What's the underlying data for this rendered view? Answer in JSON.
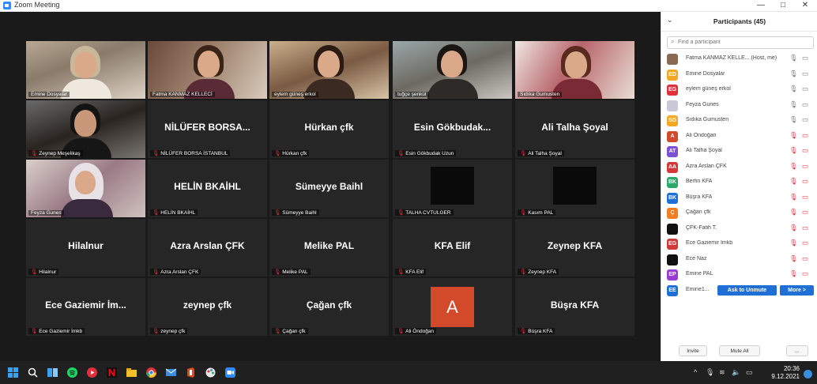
{
  "window": {
    "title": "Zoom Meeting",
    "minimize": "—",
    "restore": "□",
    "close": "✕"
  },
  "gallery": {
    "row1": [
      {
        "label": "Emine Dosyalar"
      },
      {
        "label": "Fatma KANMAZ KELLECİ"
      },
      {
        "label": "eylem güneş erkol"
      },
      {
        "label": "tuğçe şenkül"
      },
      {
        "label": "Sıdıka Gumusten"
      }
    ],
    "row2": [
      {
        "label": "Zeynep Meşelikaş"
      },
      {
        "name": "NİLÜFER BORSA...",
        "label": "NİLÜFER BORSA İSTANBUL"
      },
      {
        "name": "Hürkan çfk",
        "label": "Hürkan çfk"
      },
      {
        "name": "Esin Gökbudak...",
        "label": "Esin Gökbudak Uzun"
      },
      {
        "name": "Ali Talha Şoyal",
        "label": "Ali Talha Şoyal"
      }
    ],
    "row3": [
      {
        "label": "Feyza Gunes"
      },
      {
        "name": "HELİN BKAİHL",
        "label": "HELİN BKAİHL"
      },
      {
        "name": "Sümeyye Baihl",
        "label": "Sümeyye Baihl"
      },
      {
        "label": "TALHA CVTULGER"
      },
      {
        "label": "Kasım PAL"
      }
    ],
    "row4": [
      {
        "name": "Hilalnur",
        "label": "Hilalnur"
      },
      {
        "name": "Azra Arslan ÇFK",
        "label": "Azra Arslan ÇFK"
      },
      {
        "name": "Melike PAL",
        "label": "Melike PAL"
      },
      {
        "name": "KFA Elif",
        "label": "KFA Elif"
      },
      {
        "name": "Zeynep KFA",
        "label": "Zeynep KFA"
      }
    ],
    "row5": [
      {
        "name": "Ece Gaziemir İm...",
        "label": "Ece Gaziemir İmkb"
      },
      {
        "name": "zeynep çfk",
        "label": "zeynep çfk"
      },
      {
        "name": "Çağan çfk",
        "label": "Çağan çfk"
      },
      {
        "avatar": "A",
        "label": "Ali Öndoğan"
      },
      {
        "name": "Büşra KFA",
        "label": "Büşra KFA"
      }
    ]
  },
  "participants": {
    "title": "Participants (45)",
    "collapse_icon": "⌄",
    "search_placeholder": "Find a participant",
    "list": [
      {
        "initials": "",
        "name": "Fatma KANMAZ KELLE... (Host, me)",
        "color": "#8a6a52"
      },
      {
        "initials": "ED",
        "name": "Emine Dosyalar",
        "color": "#f5a623"
      },
      {
        "initials": "EG",
        "name": "eylem güneş erkol",
        "color": "#e0303a"
      },
      {
        "initials": "",
        "name": "Feyza Gunes",
        "color": "#c8c8d8"
      },
      {
        "initials": "SG",
        "name": "Sıdıka Gumusten",
        "color": "#f5a623"
      },
      {
        "initials": "A",
        "name": "Ali Öndoğan",
        "color": "#d24a2a"
      },
      {
        "initials": "AT",
        "name": "Ali Talha Şoyal",
        "color": "#7b4fd6"
      },
      {
        "initials": "AA",
        "name": "Azra Arslan ÇFK",
        "color": "#d23a3a"
      },
      {
        "initials": "BK",
        "name": "Berfin KFA",
        "color": "#2ca86a"
      },
      {
        "initials": "BK",
        "name": "Büşra KFA",
        "color": "#1f6fd6"
      },
      {
        "initials": "Ç",
        "name": "Çağan çfk",
        "color": "#f57c1f"
      },
      {
        "initials": "",
        "name": "ÇFK-Fatih T.",
        "color": "#111111"
      },
      {
        "initials": "EG",
        "name": "Ece Gaziemir İmkb",
        "color": "#d23a3a"
      },
      {
        "initials": "",
        "name": "Ece Naz",
        "color": "#111111"
      },
      {
        "initials": "EP",
        "name": "Emine PAL",
        "color": "#9a3ad2"
      },
      {
        "initials": "EE",
        "name": "Emine1...",
        "color": "#1f6fd6"
      }
    ],
    "ask_to_unmute": "Ask to Unmute",
    "more": "More >",
    "invite": "Invite",
    "mute_all": "Mute All",
    "ellipsis": "..."
  },
  "taskbar": {
    "time": "20:36",
    "date": "9.12.2021"
  }
}
